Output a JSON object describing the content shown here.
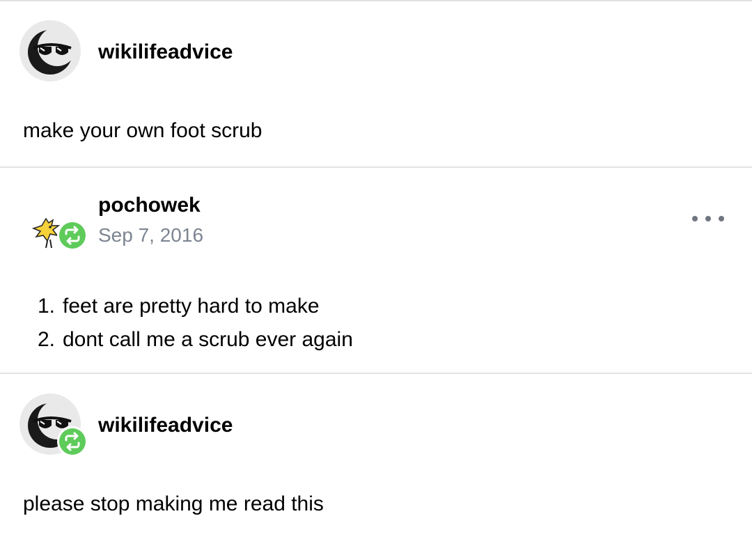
{
  "posts": [
    {
      "username": "wikilifeadvice",
      "body": "make your own foot scrub"
    },
    {
      "username": "pochowek",
      "date": "Sep 7, 2016",
      "list": [
        {
          "num": "1.",
          "text": "feet are pretty hard to make"
        },
        {
          "num": "2.",
          "text": "dont call me a scrub ever again"
        }
      ]
    },
    {
      "username": "wikilifeadvice",
      "body": "please stop making me read this"
    }
  ],
  "icons": {
    "avatar": "sunglasses-moon-avatar-icon",
    "avatar2": "yellow-bird-avatar-icon",
    "reblog": "reblog-icon",
    "more": "more-options-icon"
  },
  "colors": {
    "reblog_badge": "#5ecb5a",
    "divider": "#e2e2e2",
    "date": "#7c8591"
  }
}
